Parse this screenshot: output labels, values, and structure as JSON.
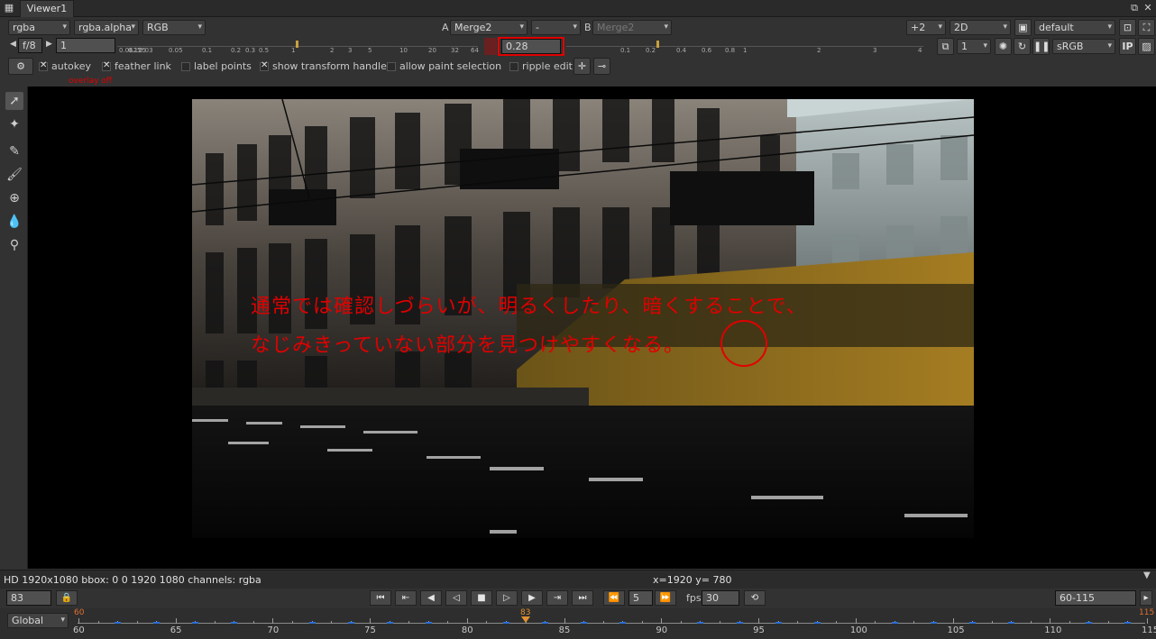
{
  "tab": {
    "title": "Viewer1"
  },
  "toolbar1": {
    "channels": "rgba",
    "alpha": "rgba.alpha",
    "display": "RGB",
    "a_label": "A",
    "a_input": "Merge2",
    "op": "-",
    "b_label": "B",
    "b_input": "Merge2",
    "downscale": "+2",
    "view_mode": "2D",
    "lut": "default"
  },
  "toolbar2": {
    "fstop": "f/8",
    "gain_value": "1",
    "gamma_value": "0.28",
    "gain_ticks": [
      "0.0625",
      "0.125",
      "0.03",
      "0.05",
      "0.1",
      "0.2",
      "0.3",
      "0.5",
      "1",
      "2",
      "3",
      "5",
      "10",
      "20",
      "32",
      "64"
    ],
    "gamma_ticks": [
      "0.1",
      "0.2",
      "0.4",
      "0.6",
      "0.8",
      "1",
      "2",
      "3",
      "4"
    ],
    "proxy": "1",
    "colorspace": "sRGB",
    "ip_label": "IP"
  },
  "toolbar3": {
    "autokey": {
      "label": "autokey",
      "checked": true
    },
    "feather_link": {
      "label": "feather link",
      "checked": true
    },
    "label_points": {
      "label": "label points",
      "checked": false
    },
    "show_transform_handle": {
      "label": "show transform handle",
      "checked": true
    },
    "allow_paint_selection": {
      "label": "allow paint selection",
      "checked": false
    },
    "ripple_edit": {
      "label": "ripple edit",
      "checked": false
    },
    "overlay_status": "overlay off"
  },
  "annotation": {
    "line1": "通常では確認しづらいが、明るくしたり、暗くすることで、",
    "line2": "なじみきっていない部分を見つけやすくなる。",
    "color": "#e00000"
  },
  "status": {
    "info": "HD 1920x1080 bbox: 0 0 1920 1080 channels: rgba",
    "coords": "x=1920 y= 780"
  },
  "transport": {
    "frame": "83",
    "step": "5",
    "fps_label": "fps",
    "fps": "30",
    "range": "60-115"
  },
  "timeline": {
    "scope": "Global",
    "labels": [
      "60",
      "65",
      "70",
      "75",
      "80",
      "85",
      "90",
      "95",
      "100",
      "105",
      "110",
      "115"
    ],
    "in_marker": "60",
    "current_marker": "83",
    "out_marker": "115"
  }
}
